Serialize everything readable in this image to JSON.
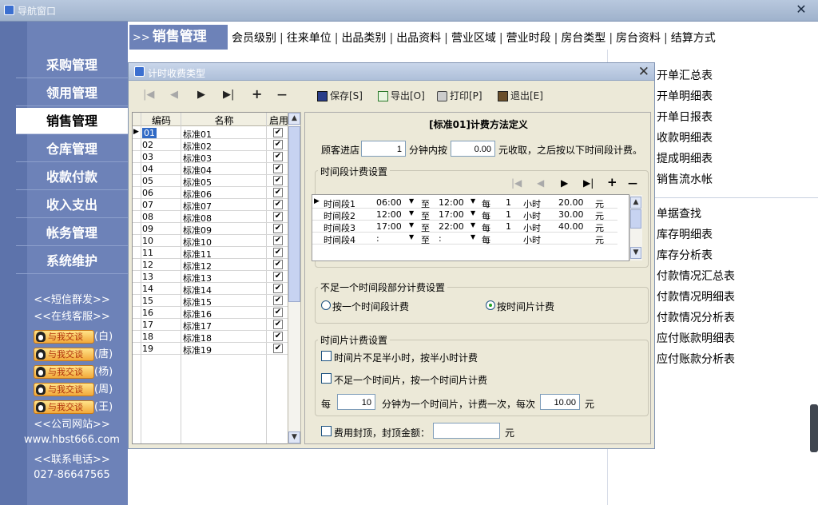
{
  "window": {
    "title": "导航窗口"
  },
  "sidebar": {
    "items": [
      {
        "label": "采购管理"
      },
      {
        "label": "领用管理"
      },
      {
        "label": "销售管理",
        "active": true
      },
      {
        "label": "仓库管理"
      },
      {
        "label": "收款付款"
      },
      {
        "label": "收入支出"
      },
      {
        "label": "帐务管理"
      },
      {
        "label": "系统维护"
      }
    ],
    "sms": "<<短信群发>>",
    "service": "<<在线客服>>",
    "qq_button": "与我交谈",
    "qq": [
      {
        "name": "(白)"
      },
      {
        "name": "(唐)"
      },
      {
        "name": "(杨)"
      },
      {
        "name": "(周)"
      },
      {
        "name": "(王)"
      }
    ],
    "website_label": "<<公司网站>>",
    "website": "www.hbst666.com",
    "phone_label": "<<联系电话>>",
    "phone": "027-86647565"
  },
  "topnav": {
    "arrow": ">>",
    "title": "销售管理",
    "links": [
      "会员级别",
      "往来单位",
      "出品类别",
      "出品资料",
      "营业区域",
      "营业时段",
      "房台类型",
      "房台资料",
      "结算方式"
    ]
  },
  "rightlinks": {
    "group1": [
      "开单汇总表",
      "开单明细表",
      "开单日报表",
      "收款明细表",
      "提成明细表",
      "销售流水帐"
    ],
    "group2": [
      "单据查找",
      "库存明细表",
      "库存分析表",
      "付款情况汇总表",
      "付款情况明细表",
      "付款情况分析表",
      "应付账款明细表",
      "应付账款分析表"
    ]
  },
  "dialog": {
    "title": "计时收费类型",
    "toolbar": {
      "first": "|◀",
      "prev": "◀",
      "next": "▶",
      "last": "▶|",
      "add": "+",
      "remove": "—",
      "save": "保存[S]",
      "export": "导出[O]",
      "print": "打印[P]",
      "exit": "退出[E]"
    },
    "grid": {
      "headers": {
        "code": "编码",
        "name": "名称",
        "enabled": "启用"
      },
      "rows": [
        {
          "code": "01",
          "name": "标准01"
        },
        {
          "code": "02",
          "name": "标准02"
        },
        {
          "code": "03",
          "name": "标准03"
        },
        {
          "code": "04",
          "name": "标准04"
        },
        {
          "code": "05",
          "name": "标准05"
        },
        {
          "code": "06",
          "name": "标准06"
        },
        {
          "code": "07",
          "name": "标准07"
        },
        {
          "code": "08",
          "name": "标准08"
        },
        {
          "code": "09",
          "name": "标准09"
        },
        {
          "code": "10",
          "name": "标准10"
        },
        {
          "code": "11",
          "name": "标准11"
        },
        {
          "code": "12",
          "name": "标准12"
        },
        {
          "code": "13",
          "name": "标准13"
        },
        {
          "code": "14",
          "name": "标准14"
        },
        {
          "code": "15",
          "name": "标准15"
        },
        {
          "code": "16",
          "name": "标准16"
        },
        {
          "code": "17",
          "name": "标准17"
        },
        {
          "code": "18",
          "name": "标准18"
        },
        {
          "code": "19",
          "name": "标准19"
        }
      ],
      "checkmark": "✔"
    },
    "method": {
      "title": "[标准01]计费方法定义",
      "prefix": "顾客进店",
      "minutes": "1",
      "mid": "分钟内按",
      "amount": "0.00",
      "suffix": "元收取，之后按以下时间段计费。",
      "segments_title": "时间段计费设置",
      "segments": [
        {
          "name": "时间段1",
          "start": "06:00",
          "to": "至",
          "end": "12:00",
          "per": "每",
          "qty": "1",
          "unit": "小时",
          "price": "20.00",
          "cur": "元"
        },
        {
          "name": "时间段2",
          "start": "12:00",
          "to": "至",
          "end": "17:00",
          "per": "每",
          "qty": "1",
          "unit": "小时",
          "price": "30.00",
          "cur": "元"
        },
        {
          "name": "时间段3",
          "start": "17:00",
          "to": "至",
          "end": "22:00",
          "per": "每",
          "qty": "1",
          "unit": "小时",
          "price": "40.00",
          "cur": "元"
        },
        {
          "name": "时间段4",
          "start": ":",
          "to": "至",
          "end": ":",
          "per": "每",
          "qty": "",
          "unit": "小时",
          "price": "",
          "cur": "元"
        }
      ],
      "partial_title": "不足一个时间段部分计费设置",
      "opt1": "按一个时间段计费",
      "opt2": "按时间片计费",
      "slice_title": "时间片计费设置",
      "chk1": "时间片不足半小时，按半小时计费",
      "chk2": "不足一个时间片，按一个时间片计费",
      "every": "每",
      "slice_min": "10",
      "slice_mid": "分钟为一个时间片，计费一次，每次",
      "slice_price": "10.00",
      "yuan": "元",
      "cap": "费用封顶，封顶金额：",
      "cap_value": "",
      "cap_yuan": "元"
    }
  }
}
